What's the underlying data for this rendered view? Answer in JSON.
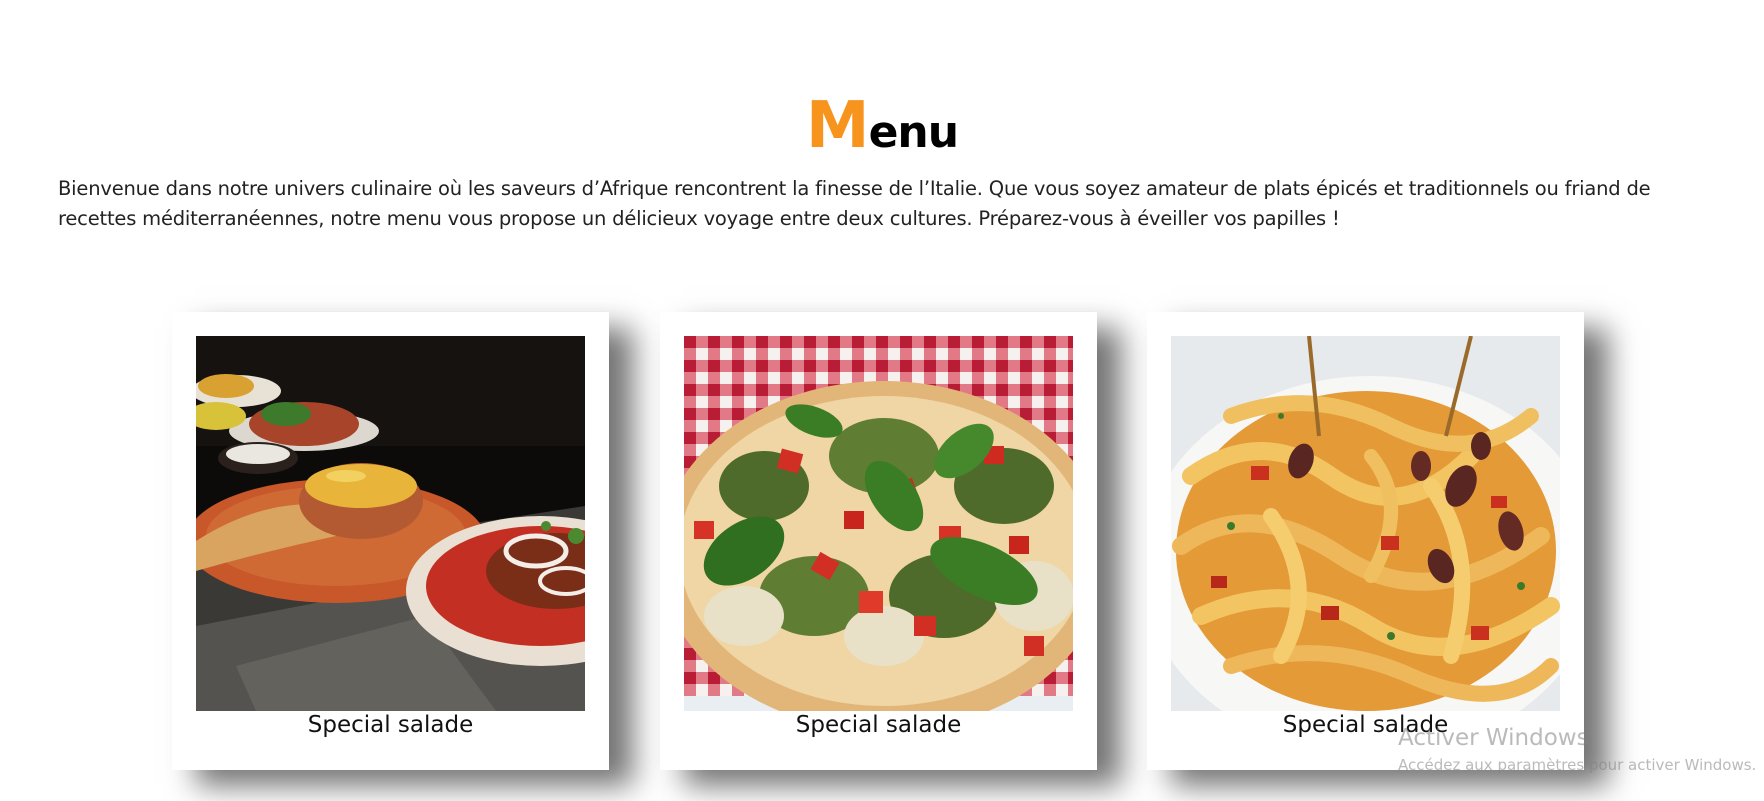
{
  "section": {
    "title_first_letter": "M",
    "title_rest": "enu",
    "intro": "Bienvenue dans notre univers culinaire où les saveurs d’Afrique rencontrent la finesse de l’Italie. Que vous soyez amateur de plats épicés et traditionnels ou friand de recettes méditerranéennes, notre menu vous propose un délicieux voyage entre deux cultures. Préparez-vous à éveiller vos papilles !"
  },
  "cards": [
    {
      "caption": "Special salade"
    },
    {
      "caption": "Special salade"
    },
    {
      "caption": "Special salade"
    }
  ],
  "watermark": {
    "title": "Activer Windows",
    "subtitle": "Accédez aux paramètres pour activer Windows."
  },
  "colors": {
    "accent": "#f7941d",
    "text": "#222222",
    "card_bg": "#ffffff"
  }
}
